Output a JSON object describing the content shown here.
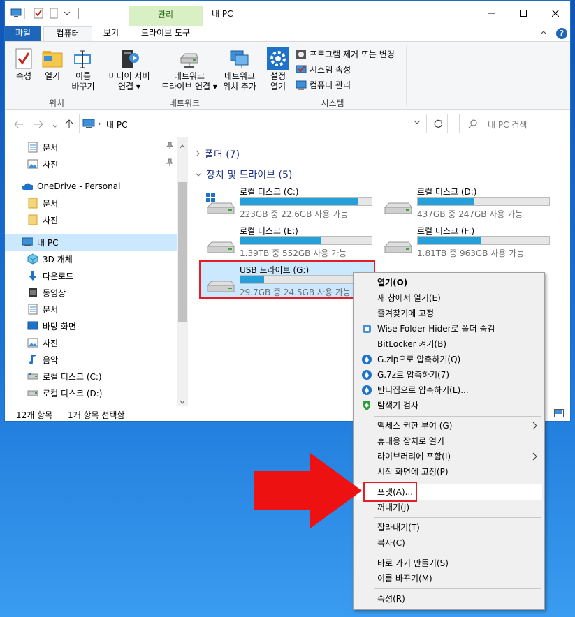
{
  "window": {
    "title": "내 PC",
    "context_tab": "관리"
  },
  "ribbon_tabs": [
    "파일",
    "컴퓨터",
    "보기",
    "드라이브 도구"
  ],
  "ribbon": {
    "location": {
      "label": "위치",
      "properties": "속성",
      "open": "열기",
      "rename_line1": "이름",
      "rename_line2": "바꾸기"
    },
    "network": {
      "label": "네트워크",
      "media_line1": "미디어 서버",
      "media_line2": "연결 ▾",
      "map_line1": "네트워크",
      "map_line2": "드라이브 연결 ▾",
      "add_line1": "네트워크",
      "add_line2": "위치 추가"
    },
    "system": {
      "label": "시스템",
      "settings_line1": "설정",
      "settings_line2": "열기",
      "uninstall": "프로그램 제거 또는 변경",
      "sys_props": "시스템 속성",
      "manage": "컴퓨터 관리"
    }
  },
  "address": {
    "path": "내 PC",
    "search_placeholder": "내 PC 검색"
  },
  "nav": [
    {
      "label": "문서",
      "icon": "document-icon",
      "pinned": true
    },
    {
      "label": "사진",
      "icon": "pictures-icon",
      "pinned": true
    },
    {
      "label": "OneDrive - Personal",
      "icon": "onedrive-icon"
    },
    {
      "label": "문서",
      "icon": "folder-icon"
    },
    {
      "label": "사진",
      "icon": "folder-icon"
    },
    {
      "label": "내 PC",
      "icon": "pc-icon",
      "selected": true
    },
    {
      "label": "3D 개체",
      "icon": "cube-icon"
    },
    {
      "label": "다운로드",
      "icon": "download-icon"
    },
    {
      "label": "동영상",
      "icon": "video-icon"
    },
    {
      "label": "문서",
      "icon": "document-icon"
    },
    {
      "label": "바탕 화면",
      "icon": "desktop-icon"
    },
    {
      "label": "사진",
      "icon": "pictures-icon"
    },
    {
      "label": "음악",
      "icon": "music-icon"
    },
    {
      "label": "로컬 디스크 (C:)",
      "icon": "drive-icon"
    },
    {
      "label": "로컬 디스크 (D:)",
      "icon": "drive-icon"
    }
  ],
  "content": {
    "folders_header": "폴더 (7)",
    "devices_header": "장치 및 드라이브 (5)",
    "drives": [
      {
        "name": "로컬 디스크 (C:)",
        "info": "223GB 중 22.6GB 사용 가능",
        "used": 0.9,
        "windows": true
      },
      {
        "name": "로컬 디스크 (D:)",
        "info": "437GB 중 247GB 사용 가능",
        "used": 0.43
      },
      {
        "name": "로컬 디스크 (E:)",
        "info": "1.39TB 중 552GB 사용 가능",
        "used": 0.61
      },
      {
        "name": "로컬 디스크 (F:)",
        "info": "1.81TB 중 963GB 사용 가능",
        "used": 0.48
      },
      {
        "name": "USB 드라이브 (G:)",
        "info": "29.7GB 중 24.5GB 사용 가능",
        "used": 0.18,
        "selected": true
      }
    ]
  },
  "status": {
    "count": "12개 항목",
    "selected": "1개 항목 선택함"
  },
  "context_menu": [
    {
      "label": "열기(O)",
      "bold": true
    },
    {
      "label": "새 창에서 열기(E)"
    },
    {
      "label": "즐겨찾기에 고정"
    },
    {
      "label": "Wise Folder Hider로 폴더 숨김",
      "icon": "wise-icon"
    },
    {
      "label": "BitLocker 켜기(B)"
    },
    {
      "label": "G.zip으로 압축하기(Q)",
      "icon": "bandizip-icon"
    },
    {
      "label": "G.7z로 압축하기(7)",
      "icon": "bandizip-icon"
    },
    {
      "label": "반디집으로 압축하기(L)...",
      "icon": "bandizip-icon"
    },
    {
      "label": "탐색기 검사",
      "icon": "shield-icon"
    },
    {
      "sep": true
    },
    {
      "label": "액세스 권한 부여 (G)",
      "submenu": true
    },
    {
      "label": "휴대용 장치로 열기"
    },
    {
      "label": "라이브러리에 포함(I)",
      "submenu": true
    },
    {
      "label": "시작 화면에 고정(P)"
    },
    {
      "sep": true
    },
    {
      "label": "포맷(A)...",
      "hover": true
    },
    {
      "label": "꺼내기(J)"
    },
    {
      "sep": true
    },
    {
      "label": "잘라내기(T)"
    },
    {
      "label": "복사(C)"
    },
    {
      "sep": true
    },
    {
      "label": "바로 가기 만들기(S)"
    },
    {
      "label": "이름 바꾸기(M)"
    },
    {
      "sep": true
    },
    {
      "label": "속성(R)"
    }
  ],
  "colors": {
    "accent": "#1e66b9",
    "selection": "#cce8ff",
    "highlight_red": "#e41e26",
    "progress": "#26a0da"
  }
}
